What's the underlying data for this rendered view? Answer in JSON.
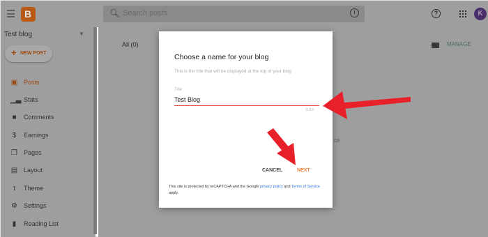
{
  "topbar": {
    "search_placeholder": "Search posts",
    "avatar_letter": "K"
  },
  "sidebar": {
    "blog_name": "Test blog",
    "new_post_label": "NEW POST",
    "items": [
      {
        "label": "Posts",
        "icon": "posts-icon"
      },
      {
        "label": "Stats",
        "icon": "stats-icon"
      },
      {
        "label": "Comments",
        "icon": "comments-icon"
      },
      {
        "label": "Earnings",
        "icon": "dollar-icon"
      },
      {
        "label": "Pages",
        "icon": "pages-icon"
      },
      {
        "label": "Layout",
        "icon": "layout-icon"
      },
      {
        "label": "Theme",
        "icon": "theme-icon"
      },
      {
        "label": "Settings",
        "icon": "gear-icon"
      },
      {
        "label": "Reading List",
        "icon": "bookmark-icon"
      }
    ]
  },
  "main": {
    "tab_all": "All (0)",
    "manage_label": "MANAGE",
    "background_text": "ce"
  },
  "dialog": {
    "title": "Choose a name for your blog",
    "subtitle": "This is the title that will be displayed at the top of your blog",
    "field_label": "Title",
    "field_value": "Test Blog",
    "char_count": "9/100",
    "cancel_label": "CANCEL",
    "next_label": "NEXT",
    "recaptcha_prefix": "This site is protected by reCAPTCHA and the Google",
    "privacy_link": "privacy policy",
    "and_text": "and",
    "terms_link": "Terms of Service",
    "recaptcha_suffix": "apply."
  },
  "colors": {
    "accent": "#f57c32",
    "field_underline": "#e8574a",
    "arrow": "#e8202a",
    "overlay": "#9e9e9e"
  }
}
